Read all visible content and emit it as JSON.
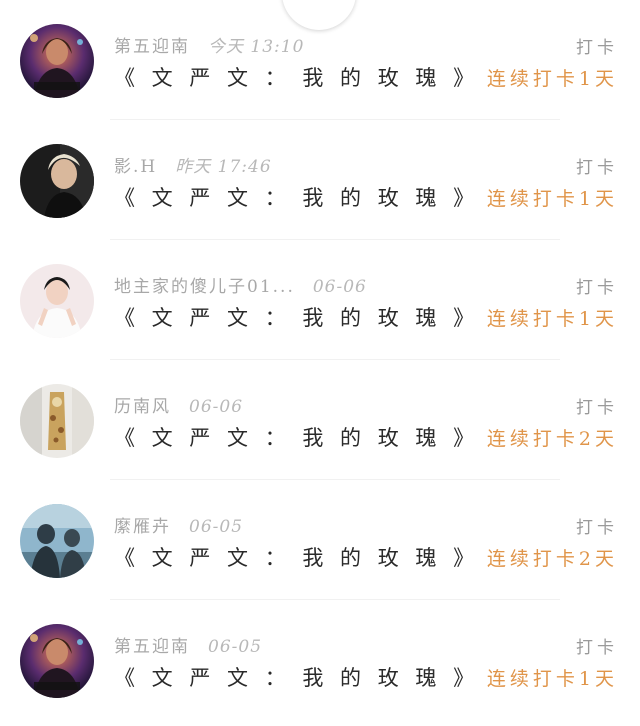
{
  "feed": [
    {
      "user": "第五迎南",
      "time": "今天 13:10",
      "title": "《 文 严 文 ： 我 的 玫 瑰 》",
      "action": "打卡",
      "streak": "连续打卡1天",
      "avatar": "avatar-a"
    },
    {
      "user": "影.H",
      "time": "昨天 17:46",
      "title": "《 文 严 文 ： 我 的 玫 瑰 》",
      "action": "打卡",
      "streak": "连续打卡1天",
      "avatar": "avatar-b"
    },
    {
      "user": "地主家的傻儿子01...",
      "time": "06-06",
      "title": "《 文 严 文 ： 我 的 玫 瑰 》",
      "action": "打卡",
      "streak": "连续打卡1天",
      "avatar": "avatar-c"
    },
    {
      "user": "历南风",
      "time": "06-06",
      "title": "《 文 严 文 ： 我 的 玫 瑰 》",
      "action": "打卡",
      "streak": "连续打卡2天",
      "avatar": "avatar-d"
    },
    {
      "user": "縻雁卉",
      "time": "06-05",
      "title": "《 文 严 文 ： 我 的 玫 瑰 》",
      "action": "打卡",
      "streak": "连续打卡2天",
      "avatar": "avatar-e"
    },
    {
      "user": "第五迎南",
      "time": "06-05",
      "title": "《 文 严 文 ： 我 的 玫 瑰 》",
      "action": "打卡",
      "streak": "连续打卡1天",
      "avatar": "avatar-a"
    }
  ]
}
